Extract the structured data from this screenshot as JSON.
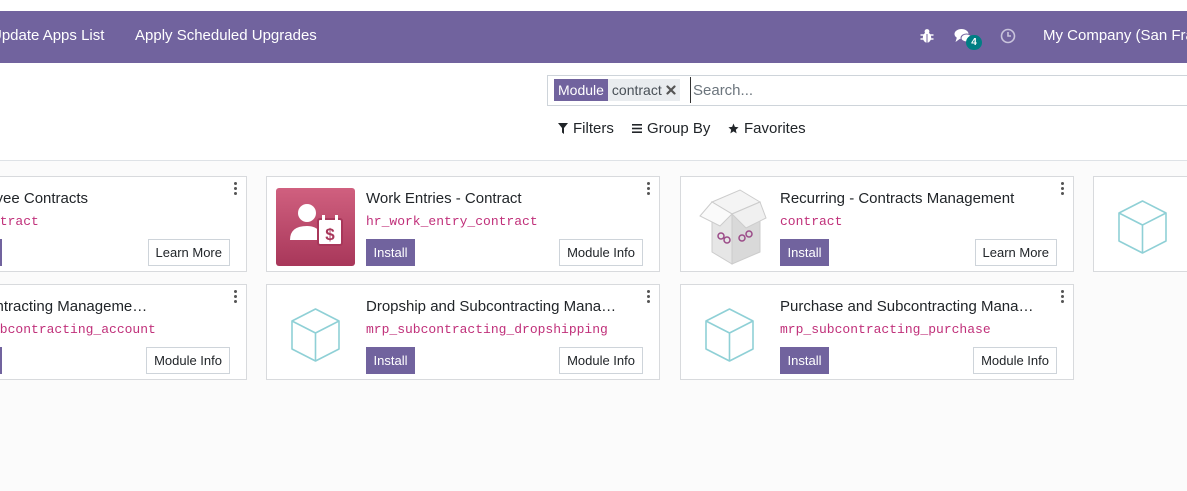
{
  "navbar": {
    "update_apps": "Update Apps List",
    "apply_upgrades": "Apply Scheduled Upgrades",
    "messages_count": "4",
    "company": "My Company (San Francisco)",
    "icons": [
      "bug-icon",
      "chat-icon",
      "clock-icon"
    ]
  },
  "search": {
    "facet_label": "Module",
    "facet_value": "contract",
    "placeholder": "Search...",
    "filters": "Filters",
    "group_by": "Group By",
    "favorites": "Favorites"
  },
  "buttons": {
    "install": "Install",
    "learn_more": "Learn More",
    "module_info": "Module Info"
  },
  "modules": [
    {
      "title": "Employee Contracts",
      "tech": "hr_contract",
      "action": "Learn More",
      "icon": "partial-icon"
    },
    {
      "title": "Work Entries - Contract",
      "tech": "hr_work_entry_contract",
      "action": "Module Info",
      "icon": "work-entries-icon"
    },
    {
      "title": "Recurring - Contracts Management",
      "tech": "contract",
      "action": "Learn More",
      "icon": "oca-box-icon"
    },
    {
      "title": "Subcontracting Management with Stock Valuation",
      "tech": "mrp_subcontracting_account",
      "action": "Module Info",
      "icon": "cube-icon"
    },
    {
      "title": "Dropship and Subcontracting Management",
      "tech": "mrp_subcontracting_dropshipping",
      "action": "Module Info",
      "icon": "cube-icon"
    },
    {
      "title": "Purchase and Subcontracting Management",
      "tech": "mrp_subcontracting_purchase",
      "action": "Module Info",
      "icon": "cube-icon"
    }
  ],
  "colors": {
    "brand": "#71639e",
    "tech_name": "#c0307a",
    "badge": "#017e84"
  }
}
